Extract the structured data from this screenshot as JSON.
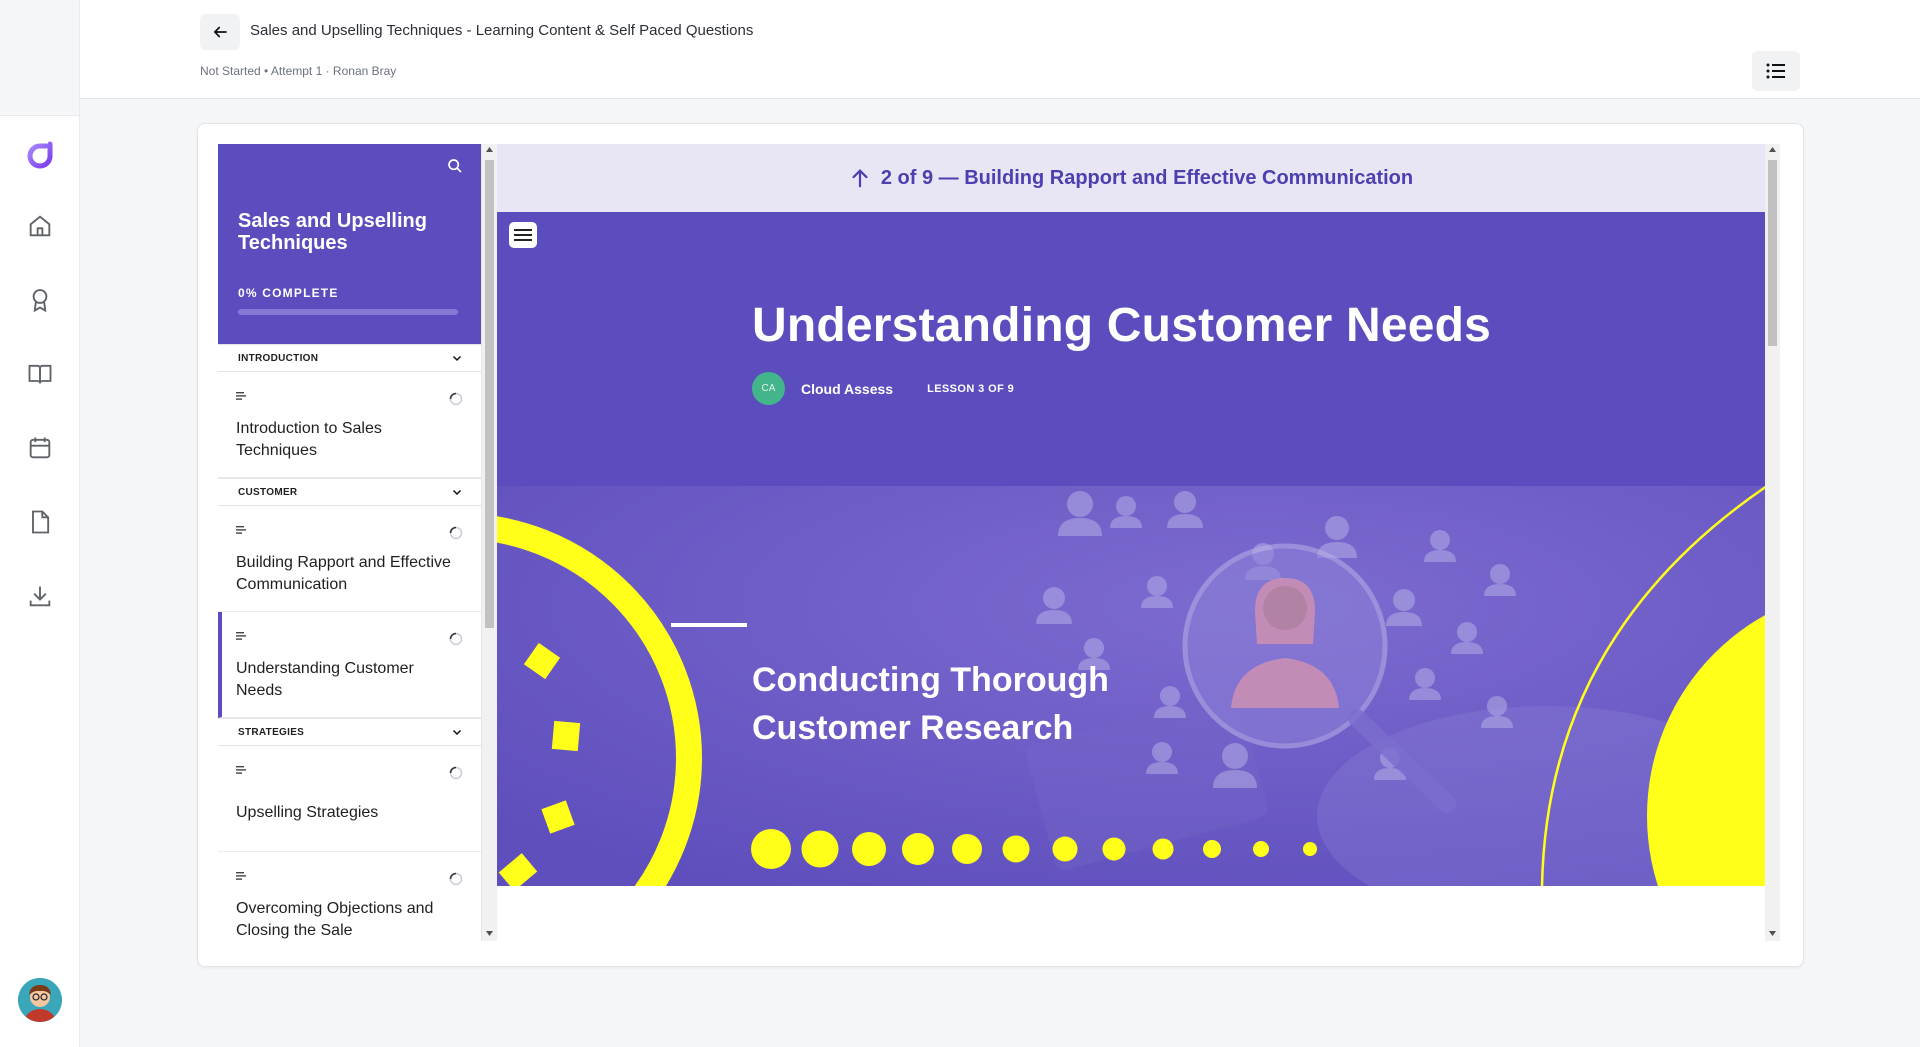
{
  "header": {
    "title": "Sales and Upselling Techniques - Learning Content & Self Paced Questions",
    "meta": "Not Started • Attempt 1 · Ronan Bray"
  },
  "rail": {
    "items": [
      {
        "icon": "home-icon"
      },
      {
        "icon": "award-icon"
      },
      {
        "icon": "book-icon"
      },
      {
        "icon": "calendar-icon"
      },
      {
        "icon": "document-icon"
      },
      {
        "icon": "download-icon"
      }
    ]
  },
  "course": {
    "title": "Sales and Upselling Techniques",
    "progress_label": "0% COMPLETE",
    "progress": 0,
    "sections": [
      {
        "name": "INTRODUCTION",
        "lessons": [
          {
            "label": "Introduction to Sales Techniques"
          }
        ]
      },
      {
        "name": "CUSTOMER",
        "lessons": [
          {
            "label": "Building Rapport and Effective Communication"
          },
          {
            "label": "Understanding Customer Needs"
          }
        ]
      },
      {
        "name": "STRATEGIES",
        "lessons": [
          {
            "label": "Upselling Strategies"
          },
          {
            "label": "Overcoming Objections and Closing the Sale"
          }
        ]
      }
    ]
  },
  "lesson": {
    "prev_nav": "2 of 9 — Building Rapport and Effective Communication",
    "title": "Understanding Customer Needs",
    "author_initials": "CA",
    "author": "Cloud Assess",
    "lesson_count": "LESSON 3 OF 9",
    "banner_heading": "Conducting Thorough Customer Research"
  },
  "colors": {
    "accent": "#5b4dbe",
    "nav_strip": "#e8e6f5",
    "banner_yellow": "#ffff1a",
    "avatar_green": "#43b58a"
  }
}
